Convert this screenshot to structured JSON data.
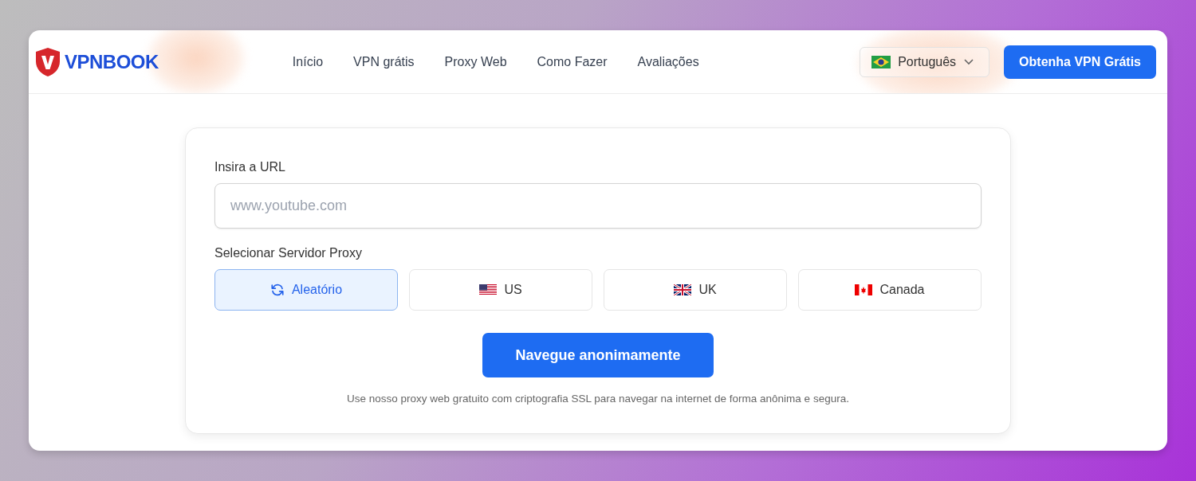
{
  "header": {
    "logo": "VPNBOOK",
    "nav": [
      {
        "label": "Início"
      },
      {
        "label": "VPN grátis"
      },
      {
        "label": "Proxy Web"
      },
      {
        "label": "Como Fazer"
      },
      {
        "label": "Avaliações"
      }
    ],
    "language": {
      "label": "Português",
      "kind": "br"
    },
    "cta": "Obtenha VPN Grátis"
  },
  "form": {
    "url_label": "Insira a URL",
    "url_placeholder": "www.youtube.com",
    "server_label": "Selecionar Servidor Proxy",
    "servers": [
      {
        "label": "Aleatório",
        "kind": "random",
        "selected": true
      },
      {
        "label": "US",
        "kind": "us",
        "selected": false
      },
      {
        "label": "UK",
        "kind": "uk",
        "selected": false
      },
      {
        "label": "Canada",
        "kind": "ca",
        "selected": false
      }
    ],
    "submit": "Navegue anonimamente",
    "note": "Use nosso proxy web gratuito com criptografia SSL para navegar na internet de forma anônima e segura."
  }
}
